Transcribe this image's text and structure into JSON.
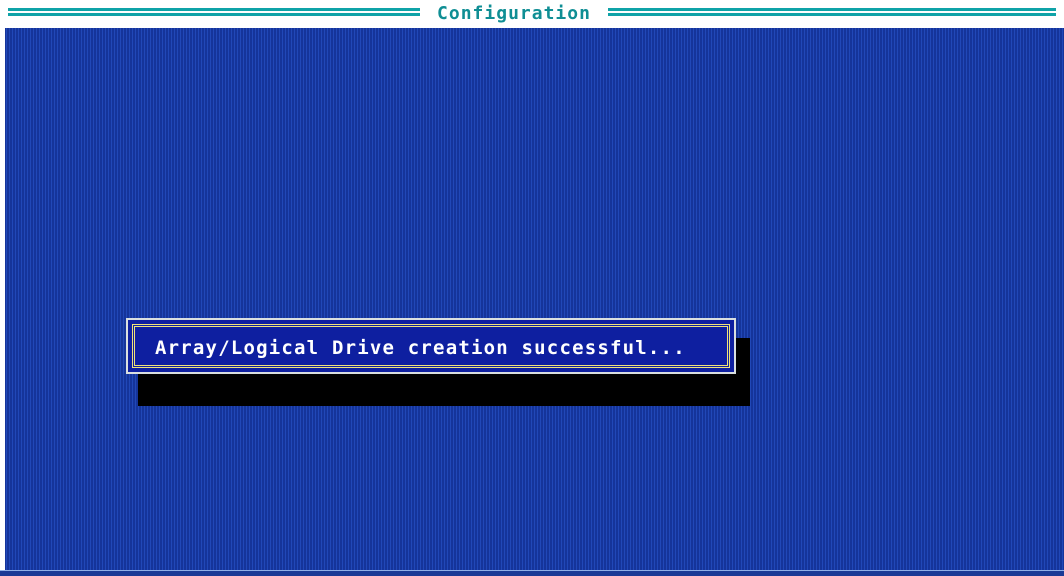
{
  "window": {
    "title": "Configuration"
  },
  "dialog": {
    "message": "Array/Logical Drive creation successful..."
  },
  "colors": {
    "background": "#1a3fa3",
    "title_text": "#0f8e94",
    "title_rule": "#0fa3a8",
    "dialog_background": "#0e1fa0",
    "dialog_border": "#efe37a",
    "dialog_text": "#ffffff",
    "shadow": "#000000"
  }
}
